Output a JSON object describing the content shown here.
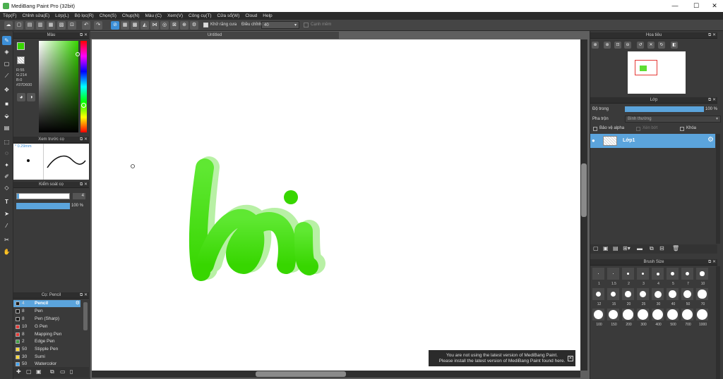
{
  "window": {
    "title": "MediBang Paint Pro (32bit)",
    "min": "—",
    "max": "☐",
    "close": "✕"
  },
  "menu": [
    "Tệp(F)",
    "Chỉnh sửa(E)",
    "Lớp(L)",
    "Bộ lọc(R)",
    "Chọn(S)",
    "Chụp(N)",
    "Màu (C)",
    "Xem(V)",
    "Công cụ(T)",
    "Cửa sổ(W)",
    "Cloud",
    "Help"
  ],
  "toolbar": {
    "antialias_label": "Khử răng cưa",
    "adjust_label": "Điều chỉnh",
    "adjust_value": "40",
    "edge_label": "Cạnh mềm"
  },
  "color_panel": {
    "title": "Màu",
    "r": "R:55",
    "g": "G:214",
    "b": "B:0",
    "hex": "#37D600",
    "fg": "#37d600"
  },
  "brush_preview": {
    "title": "Xem trước cọ",
    "size": "0.29mm"
  },
  "brush_control": {
    "title": "Kiểm soát cọ",
    "size_value": "4",
    "opacity_value": "100 %"
  },
  "canvas": {
    "tab": "Untitled"
  },
  "brush_panel": {
    "title": "Cọ: Pencil",
    "items": [
      {
        "num": "4",
        "name": "Pencil",
        "color": "#1a1a1a"
      },
      {
        "num": "8",
        "name": "Pen",
        "color": "#1a1a1a"
      },
      {
        "num": "8",
        "name": "Pen (Sharp)",
        "color": "#1a1a1a"
      },
      {
        "num": "10",
        "name": "G Pen",
        "color": "#e53935"
      },
      {
        "num": "8",
        "name": "Mapping Pen",
        "color": "#e53935"
      },
      {
        "num": "2",
        "name": "Edge Pen",
        "color": "#43a047"
      },
      {
        "num": "50",
        "name": "Stipple Pen",
        "color": "#fdd835"
      },
      {
        "num": "30",
        "name": "Sumi",
        "color": "#fdd835"
      },
      {
        "num": "50",
        "name": "Watercolor",
        "color": "#42a5f5"
      }
    ]
  },
  "navigator": {
    "title": "Hoa tiêu"
  },
  "layer_panel": {
    "title": "Lớp",
    "opacity_label": "Độ trong",
    "opacity_value": "100 %",
    "opacity": 1.0,
    "blend_label": "Pha trộn",
    "blend_value": "Bình thường",
    "protect_alpha": "Bảo vệ alpha",
    "clipping": "Xén bớt",
    "lock": "Khóa",
    "layers": [
      {
        "name": "Lớp1"
      }
    ]
  },
  "brush_size": {
    "title": "Brush Size",
    "sizes": [
      "1",
      "1.5",
      "2",
      "3",
      "4",
      "5",
      "7",
      "10",
      "12",
      "15",
      "20",
      "25",
      "30",
      "40",
      "50",
      "70",
      "100",
      "150",
      "200",
      "300",
      "400",
      "500",
      "700",
      "1000"
    ]
  },
  "notification": {
    "line1": "You are not using the latest version of MediBang Paint.",
    "line2": "Please install the latest version of MediBang Paint found here."
  }
}
